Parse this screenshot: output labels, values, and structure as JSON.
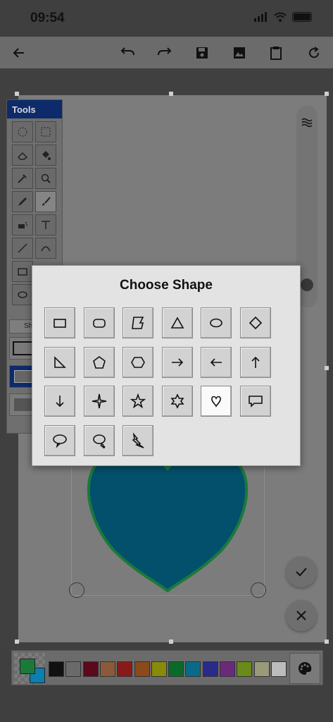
{
  "status": {
    "time": "09:54"
  },
  "toolbar": {
    "icons": [
      "arrow-left-icon",
      "undo-icon",
      "redo-icon",
      "save-icon",
      "image-icon",
      "clipboard-icon",
      "refresh-icon"
    ]
  },
  "tools_panel": {
    "title": "Tools",
    "shape_section_label": "Sh"
  },
  "dialog": {
    "title": "Choose Shape",
    "shapes": [
      "rectangle",
      "rounded-rectangle",
      "folded-corner",
      "triangle",
      "ellipse",
      "diamond",
      "right-triangle",
      "pentagon",
      "hexagon",
      "arrow-right",
      "arrow-left",
      "arrow-up",
      "arrow-down",
      "four-point-star",
      "five-point-star",
      "six-point-star",
      "heart",
      "speech-bubble-rect",
      "speech-bubble-oval",
      "thought-bubble",
      "lightning"
    ],
    "selected_shape": "heart"
  },
  "colors": {
    "heart_fill": "#02506c",
    "heart_stroke": "#1a7a3a",
    "primary_color": "#1a7a3a",
    "secondary_color": "#0a7fb0"
  },
  "palette": {
    "swatches": [
      "#111111",
      "#6a6a6a",
      "#5a0a1a",
      "#8a5a3a",
      "#8a1a1a",
      "#8a4a1a",
      "#8a8a0a",
      "#0a6a2a",
      "#0a6a8a",
      "#2a2a8a",
      "#6a2a7a",
      "#6a8a1a",
      "#9a9a7a",
      "#bcbcbc"
    ]
  }
}
